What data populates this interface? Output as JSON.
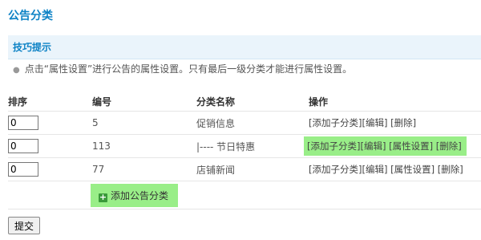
{
  "page": {
    "title": "公告分类"
  },
  "tips": {
    "title": "技巧提示",
    "items": [
      "点击“属性设置”进行公告的属性设置。只有最后一级分类才能进行属性设置。"
    ]
  },
  "table": {
    "headers": {
      "sort": "排序",
      "number": "编号",
      "name": "分类名称",
      "actions": "操作"
    },
    "rows": [
      {
        "sort": "0",
        "number": "5",
        "name": "促销信息",
        "actions": [
          "[添加子分类]",
          "[编辑]",
          "[删除]"
        ]
      },
      {
        "sort": "0",
        "number": "113",
        "name": "|---- 节日特惠",
        "actions": [
          "[添加子分类]",
          "[编辑]",
          "[属性设置]",
          "[删除]"
        ]
      },
      {
        "sort": "0",
        "number": "77",
        "name": "店铺新闻",
        "actions": [
          "[添加子分类]",
          "[编辑]",
          "[属性设置]",
          "[删除]"
        ]
      }
    ]
  },
  "add_category": {
    "label": "添加公告分类"
  },
  "submit": {
    "label": "提交"
  },
  "colors": {
    "accent": "#0d82c5",
    "highlight": "#99ee88"
  }
}
